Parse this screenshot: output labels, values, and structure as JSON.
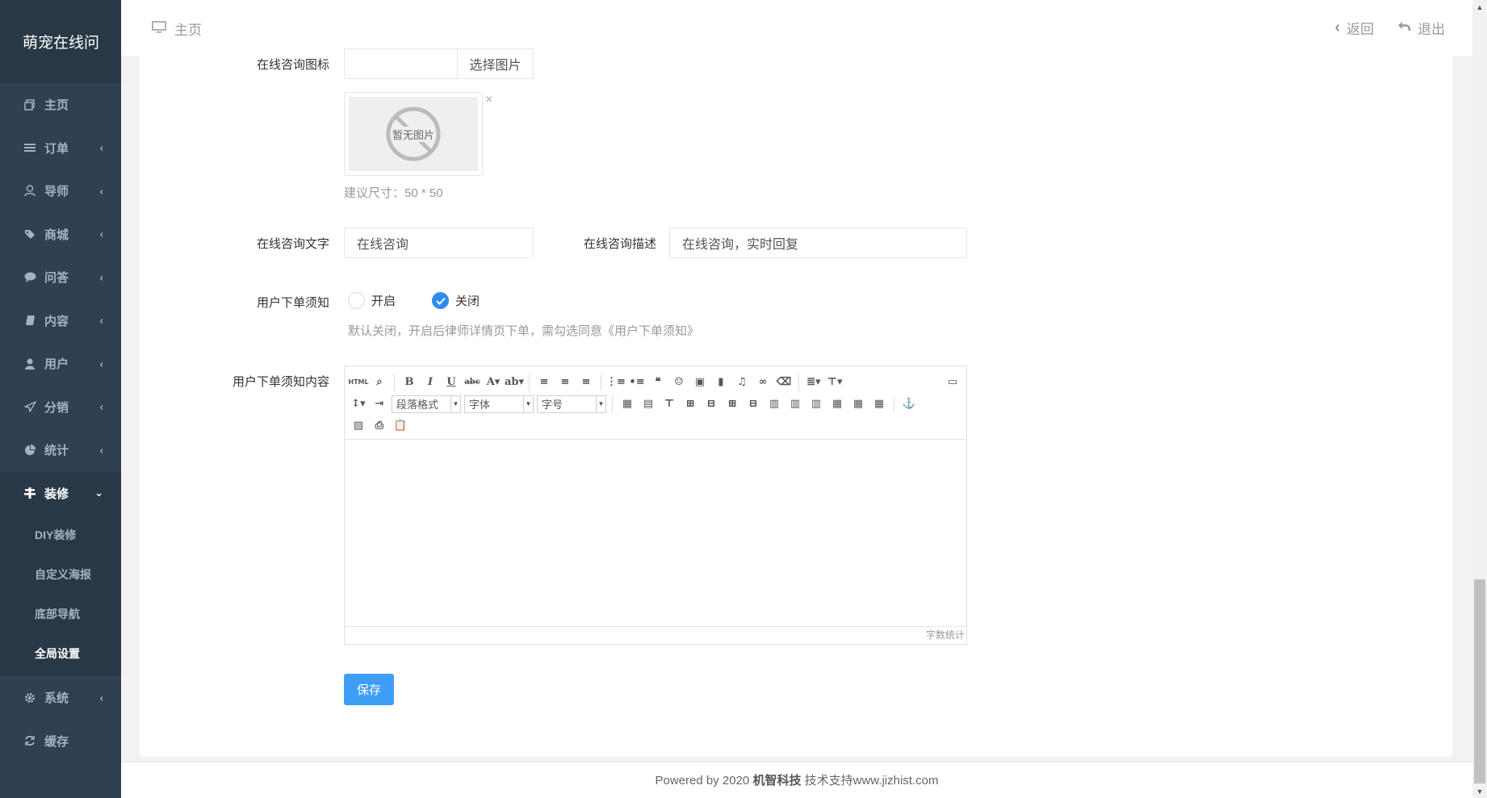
{
  "sidebar": {
    "brand": "萌宠在线问",
    "items": [
      {
        "label": "主页",
        "icon": "copy-icon"
      },
      {
        "label": "订单",
        "icon": "list-icon"
      },
      {
        "label": "导师",
        "icon": "user-icon"
      },
      {
        "label": "商城",
        "icon": "tags-icon"
      },
      {
        "label": "问答",
        "icon": "comment-icon"
      },
      {
        "label": "内容",
        "icon": "book-icon"
      },
      {
        "label": "用户",
        "icon": "person-icon"
      },
      {
        "label": "分销",
        "icon": "send-icon"
      },
      {
        "label": "统计",
        "icon": "pie-chart-icon"
      },
      {
        "label": "装修",
        "icon": "decor-icon"
      },
      {
        "label": "系统",
        "icon": "gear-icon"
      },
      {
        "label": "缓存",
        "icon": "refresh-icon"
      }
    ],
    "submenu": [
      "DIY装修",
      "自定义海报",
      "底部导航",
      "全局设置"
    ]
  },
  "topbar": {
    "home": "主页",
    "back": "返回",
    "logout": "退出"
  },
  "form": {
    "icon_label": "在线咨询图标",
    "select_image": "选择图片",
    "no_image": "暂无图片",
    "size_hint": "建议尺寸：50 * 50",
    "text_label": "在线咨询文字",
    "text_value": "在线咨询",
    "desc_label": "在线咨询描述",
    "desc_value": "在线咨询，实时回复",
    "notice_label": "用户下单须知",
    "radio_on": "开启",
    "radio_off": "关闭",
    "notice_help": "默认关闭，开启后律师详情页下单，需勾选同意《用户下单须知》",
    "content_label": "用户下单须知内容",
    "save": "保存"
  },
  "editor": {
    "html_btn": "HTML",
    "paragraph": "段落格式",
    "font": "字体",
    "size": "字号",
    "wordcount": "字数统计"
  },
  "footer": {
    "prefix": "Powered by 2020",
    "company": "机智科技",
    "suffix": "技术支持www.jizhist.com"
  },
  "colors": {
    "sidebar": "#2f4050",
    "primary": "#3e9ef5",
    "radio_checked": "#2d8cf0"
  }
}
